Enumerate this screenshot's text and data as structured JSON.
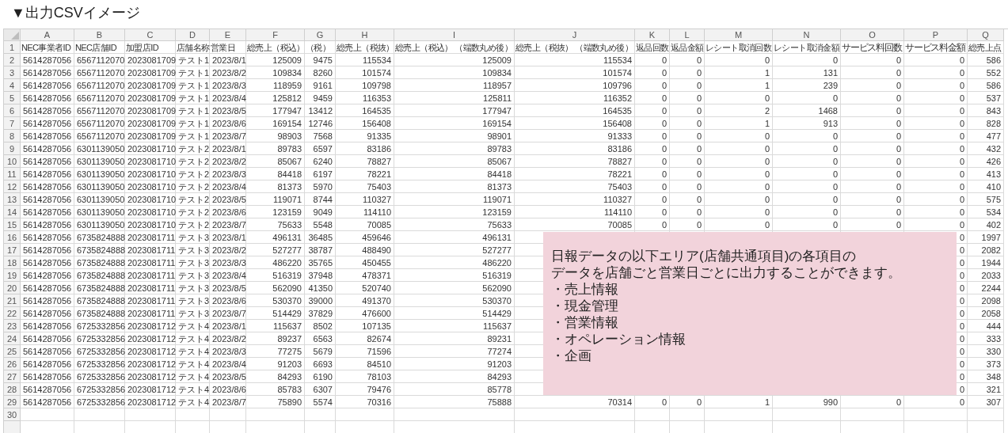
{
  "title": "▼出力CSVイメージ",
  "sheet": {
    "header_row_number": "1",
    "columns": [
      {
        "letter": "A",
        "header": "NEC事業者ID",
        "kind": "number"
      },
      {
        "letter": "B",
        "header": "NEC店舗ID",
        "kind": "number"
      },
      {
        "letter": "C",
        "header": "加盟店ID",
        "kind": "number"
      },
      {
        "letter": "D",
        "header": "店舗名称",
        "kind": "text"
      },
      {
        "letter": "E",
        "header": "営業日",
        "kind": "date"
      },
      {
        "letter": "F",
        "header": "総売上（税込）",
        "kind": "number"
      },
      {
        "letter": "G",
        "header": "（税）",
        "kind": "number"
      },
      {
        "letter": "H",
        "header": "総売上（税抜）",
        "kind": "number"
      },
      {
        "letter": "I",
        "header": "総売上（税込） （端数丸め後）",
        "kind": "number"
      },
      {
        "letter": "J",
        "header": "総売上（税抜） （端数丸め後）",
        "kind": "number"
      },
      {
        "letter": "K",
        "header": "返品回数",
        "kind": "number"
      },
      {
        "letter": "L",
        "header": "返品金額",
        "kind": "number"
      },
      {
        "letter": "M",
        "header": "レシート取消回数",
        "kind": "number"
      },
      {
        "letter": "N",
        "header": "レシート取消金額",
        "kind": "number"
      },
      {
        "letter": "O",
        "header": "サービス料回数",
        "kind": "number"
      },
      {
        "letter": "P",
        "header": "サービス料金額",
        "kind": "number"
      },
      {
        "letter": "Q",
        "header": "総売上点",
        "kind": "number"
      }
    ],
    "rows": [
      {
        "number": "2",
        "cells": [
          "5614287056",
          "6567112070",
          "2023081709",
          "テスト1",
          "2023/8/1",
          "125009",
          "9475",
          "115534",
          "125009",
          "115534",
          "0",
          "0",
          "0",
          "0",
          "0",
          "0",
          "586"
        ]
      },
      {
        "number": "3",
        "cells": [
          "5614287056",
          "6567112070",
          "2023081709",
          "テスト1",
          "2023/8/2",
          "109834",
          "8260",
          "101574",
          "109834",
          "101574",
          "0",
          "0",
          "1",
          "131",
          "0",
          "0",
          "552"
        ]
      },
      {
        "number": "4",
        "cells": [
          "5614287056",
          "6567112070",
          "2023081709",
          "テスト1",
          "2023/8/3",
          "118959",
          "9161",
          "109798",
          "118957",
          "109796",
          "0",
          "0",
          "1",
          "239",
          "0",
          "0",
          "586"
        ]
      },
      {
        "number": "5",
        "cells": [
          "5614287056",
          "6567112070",
          "2023081709",
          "テスト1",
          "2023/8/4",
          "125812",
          "9459",
          "116353",
          "125811",
          "116352",
          "0",
          "0",
          "0",
          "0",
          "0",
          "0",
          "537"
        ]
      },
      {
        "number": "6",
        "cells": [
          "5614287056",
          "6567112070",
          "2023081709",
          "テスト1",
          "2023/8/5",
          "177947",
          "13412",
          "164535",
          "177947",
          "164535",
          "0",
          "0",
          "2",
          "1468",
          "0",
          "0",
          "843"
        ]
      },
      {
        "number": "7",
        "cells": [
          "5614287056",
          "6567112070",
          "2023081709",
          "テスト1",
          "2023/8/6",
          "169154",
          "12746",
          "156408",
          "169154",
          "156408",
          "0",
          "0",
          "1",
          "913",
          "0",
          "0",
          "828"
        ]
      },
      {
        "number": "8",
        "cells": [
          "5614287056",
          "6567112070",
          "2023081709",
          "テスト1",
          "2023/8/7",
          "98903",
          "7568",
          "91335",
          "98901",
          "91333",
          "0",
          "0",
          "0",
          "0",
          "0",
          "0",
          "477"
        ]
      },
      {
        "number": "9",
        "cells": [
          "5614287056",
          "6301139050",
          "2023081710",
          "テスト2",
          "2023/8/1",
          "89783",
          "6597",
          "83186",
          "89783",
          "83186",
          "0",
          "0",
          "0",
          "0",
          "0",
          "0",
          "432"
        ]
      },
      {
        "number": "10",
        "cells": [
          "5614287056",
          "6301139050",
          "2023081710",
          "テスト2",
          "2023/8/2",
          "85067",
          "6240",
          "78827",
          "85067",
          "78827",
          "0",
          "0",
          "0",
          "0",
          "0",
          "0",
          "426"
        ]
      },
      {
        "number": "11",
        "cells": [
          "5614287056",
          "6301139050",
          "2023081710",
          "テスト2",
          "2023/8/3",
          "84418",
          "6197",
          "78221",
          "84418",
          "78221",
          "0",
          "0",
          "0",
          "0",
          "0",
          "0",
          "413"
        ]
      },
      {
        "number": "12",
        "cells": [
          "5614287056",
          "6301139050",
          "2023081710",
          "テスト2",
          "2023/8/4",
          "81373",
          "5970",
          "75403",
          "81373",
          "75403",
          "0",
          "0",
          "0",
          "0",
          "0",
          "0",
          "410"
        ]
      },
      {
        "number": "13",
        "cells": [
          "5614287056",
          "6301139050",
          "2023081710",
          "テスト2",
          "2023/8/5",
          "119071",
          "8744",
          "110327",
          "119071",
          "110327",
          "0",
          "0",
          "0",
          "0",
          "0",
          "0",
          "575"
        ]
      },
      {
        "number": "14",
        "cells": [
          "5614287056",
          "6301139050",
          "2023081710",
          "テスト2",
          "2023/8/6",
          "123159",
          "9049",
          "114110",
          "123159",
          "114110",
          "0",
          "0",
          "0",
          "0",
          "0",
          "0",
          "534"
        ]
      },
      {
        "number": "15",
        "cells": [
          "5614287056",
          "6301139050",
          "2023081710",
          "テスト2",
          "2023/8/7",
          "75633",
          "5548",
          "70085",
          "75633",
          "70085",
          "0",
          "0",
          "0",
          "0",
          "0",
          "0",
          "402"
        ]
      },
      {
        "number": "16",
        "cells": [
          "5614287056",
          "6735824888",
          "2023081711",
          "テスト3",
          "2023/8/1",
          "496131",
          "36485",
          "459646",
          "496131",
          null,
          null,
          null,
          null,
          null,
          null,
          "0",
          "1997"
        ]
      },
      {
        "number": "17",
        "cells": [
          "5614287056",
          "6735824888",
          "2023081711",
          "テスト3",
          "2023/8/2",
          "527277",
          "38787",
          "488490",
          "527277",
          null,
          null,
          null,
          null,
          null,
          null,
          "0",
          "2082"
        ]
      },
      {
        "number": "18",
        "cells": [
          "5614287056",
          "6735824888",
          "2023081711",
          "テスト3",
          "2023/8/3",
          "486220",
          "35765",
          "450455",
          "486220",
          null,
          null,
          null,
          null,
          null,
          null,
          "0",
          "1944"
        ]
      },
      {
        "number": "19",
        "cells": [
          "5614287056",
          "6735824888",
          "2023081711",
          "テスト3",
          "2023/8/4",
          "516319",
          "37948",
          "478371",
          "516319",
          null,
          null,
          null,
          null,
          null,
          null,
          "0",
          "2033"
        ]
      },
      {
        "number": "20",
        "cells": [
          "5614287056",
          "6735824888",
          "2023081711",
          "テスト3",
          "2023/8/5",
          "562090",
          "41350",
          "520740",
          "562090",
          null,
          null,
          null,
          null,
          null,
          null,
          "0",
          "2244"
        ]
      },
      {
        "number": "21",
        "cells": [
          "5614287056",
          "6735824888",
          "2023081711",
          "テスト3",
          "2023/8/6",
          "530370",
          "39000",
          "491370",
          "530370",
          null,
          null,
          null,
          null,
          null,
          null,
          "0",
          "2098"
        ]
      },
      {
        "number": "22",
        "cells": [
          "5614287056",
          "6735824888",
          "2023081711",
          "テスト3",
          "2023/8/7",
          "514429",
          "37829",
          "476600",
          "514429",
          null,
          null,
          null,
          null,
          null,
          null,
          "0",
          "2058"
        ]
      },
      {
        "number": "23",
        "cells": [
          "5614287056",
          "6725332856",
          "2023081712",
          "テスト4",
          "2023/8/1",
          "115637",
          "8502",
          "107135",
          "115637",
          null,
          null,
          null,
          null,
          null,
          null,
          "0",
          "444"
        ]
      },
      {
        "number": "24",
        "cells": [
          "5614287056",
          "6725332856",
          "2023081712",
          "テスト4",
          "2023/8/2",
          "89237",
          "6563",
          "82674",
          "89231",
          null,
          null,
          null,
          null,
          null,
          null,
          "0",
          "333"
        ]
      },
      {
        "number": "25",
        "cells": [
          "5614287056",
          "6725332856",
          "2023081712",
          "テスト4",
          "2023/8/3",
          "77275",
          "5679",
          "71596",
          "77274",
          null,
          null,
          null,
          null,
          null,
          null,
          "0",
          "330"
        ]
      },
      {
        "number": "26",
        "cells": [
          "5614287056",
          "6725332856",
          "2023081712",
          "テスト4",
          "2023/8/4",
          "91203",
          "6693",
          "84510",
          "91203",
          null,
          null,
          null,
          null,
          null,
          null,
          "0",
          "373"
        ]
      },
      {
        "number": "27",
        "cells": [
          "5614287056",
          "6725332856",
          "2023081712",
          "テスト4",
          "2023/8/5",
          "84293",
          "6190",
          "78103",
          "84293",
          null,
          null,
          null,
          null,
          null,
          null,
          "0",
          "348"
        ]
      },
      {
        "number": "28",
        "cells": [
          "5614287056",
          "6725332856",
          "2023081712",
          "テスト4",
          "2023/8/6",
          "85783",
          "6307",
          "79476",
          "85778",
          null,
          null,
          null,
          null,
          null,
          null,
          "0",
          "321"
        ]
      },
      {
        "number": "29",
        "cells": [
          "5614287056",
          "6725332856",
          "2023081712",
          "テスト4",
          "2023/8/7",
          "75890",
          "5574",
          "70316",
          "75888",
          "70314",
          "0",
          "0",
          "1",
          "990",
          "0",
          "0",
          "307"
        ]
      },
      {
        "number": "30",
        "cells": []
      }
    ]
  },
  "note": {
    "lines": [
      "日報データの以下エリア(店舗共通項目)の各項目の",
      "データを店舗ごと営業日ごとに出力することができます。"
    ],
    "items": [
      "・売上情報",
      "・現金管理",
      "・営業情報",
      "・オペレーション情報",
      "・企画"
    ]
  }
}
